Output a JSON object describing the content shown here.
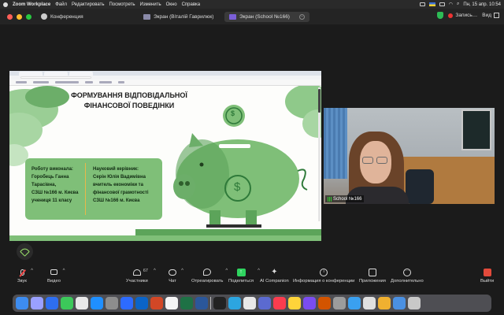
{
  "menubar": {
    "app": "Zoom Workplace",
    "items": [
      "Файл",
      "Редактировать",
      "Посмотреть",
      "Изменить",
      "Окно",
      "Справка"
    ],
    "datetime": "Пн, 15 апр.  10:54"
  },
  "titlebar": {
    "conference": "Конференция",
    "tab1": "Экран (Віталій Гаврилюк)",
    "tab2": "Экран (School №166)",
    "record": "Запись…",
    "view": "Вид"
  },
  "slide": {
    "title_line1": "ФОРМУВАННЯ ВІДПОВІДАЛЬНОЇ",
    "title_line2": "ФІНАНСОВОЇ ПОВЕДІНКИ",
    "author": "Роботу виконала:\nГоробець Ганна\nТарасівна,\nСЗШ №166 м. Києва\nучениця 11 класу",
    "supervisor": "Науковий керівник:\nСерін Юлія Вадимівна\nвчитель економіки та\nфінансової грамотності\nСЗШ №166 м. Києва",
    "coin_symbol": "$"
  },
  "camera": {
    "name": "School №166"
  },
  "toolbar": {
    "mute": "Звук",
    "video": "Видео",
    "participants": "Участники",
    "participants_count": "67",
    "chat": "Чат",
    "react": "Отреагировать",
    "share": "Поделиться",
    "ai": "AI Companion",
    "info": "Информация о конференции",
    "apps": "Приложения",
    "more": "Дополнительно",
    "leave": "Выйти"
  },
  "colors": {
    "slide_green": "#7fbf78",
    "dark_green": "#2f7a3a",
    "share_green": "#2fd35f",
    "leave_red": "#e24a3b"
  }
}
